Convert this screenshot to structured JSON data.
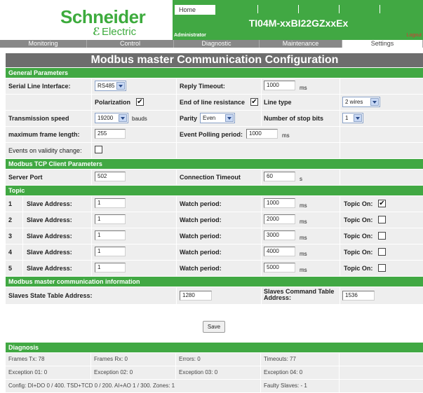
{
  "brand": {
    "name": "Schneider",
    "sub": "Electric"
  },
  "header": {
    "home_tab": "Home",
    "device_name": "TI04M-xxBI22GZxxEx",
    "user": "Administrator",
    "logout": "Logout"
  },
  "nav": [
    "Monitoring",
    "Control",
    "Diagnostic",
    "Maintenance",
    "Settings"
  ],
  "title": "Modbus master Communication Configuration",
  "general": {
    "heading": "General Parameters",
    "serial_label": "Serial Line Interface:",
    "serial_value": "RS485",
    "reply_label": "Reply Timeout:",
    "reply_value": "1000",
    "reply_unit": "ms",
    "polarization_label": "Polarization",
    "polarization_check": "✔",
    "eol_label": "End of line resistance",
    "eol_check": "✔",
    "linetype_label": "Line type",
    "linetype_value": "2 wires",
    "speed_label": "Transmission speed",
    "speed_value": "19200",
    "speed_unit": "bauds",
    "parity_label": "Parity",
    "parity_value": "Even",
    "stopbits_label": "Number of stop bits",
    "stopbits_value": "1",
    "framelen_label": "maximum frame length:",
    "framelen_value": "255",
    "polling_label": "Event Polling period:",
    "polling_value": "1000",
    "polling_unit": "ms",
    "events_label": "Events on validity change:"
  },
  "tcp": {
    "heading": "Modbus TCP Client Parameters",
    "port_label": "Server Port",
    "port_value": "502",
    "timeout_label": "Connection Timeout",
    "timeout_value": "60",
    "timeout_unit": "s"
  },
  "topic": {
    "heading": "Topic",
    "slave_label": "Slave Address:",
    "watch_label": "Watch period:",
    "watch_unit": "ms",
    "topic_on_label": "Topic On:",
    "rows": [
      {
        "num": "1",
        "slave": "1",
        "watch": "1000",
        "on": "✔"
      },
      {
        "num": "2",
        "slave": "1",
        "watch": "2000",
        "on": ""
      },
      {
        "num": "3",
        "slave": "1",
        "watch": "3000",
        "on": ""
      },
      {
        "num": "4",
        "slave": "1",
        "watch": "4000",
        "on": ""
      },
      {
        "num": "5",
        "slave": "1",
        "watch": "5000",
        "on": ""
      }
    ]
  },
  "info": {
    "heading": "Modbus master communication information",
    "state_label": "Slaves State Table Address:",
    "state_value": "1280",
    "cmd_label": "Slaves Command Table Address:",
    "cmd_value": "1536"
  },
  "save_label": "Save",
  "diagnosis": {
    "heading": "Diagnosis",
    "rows": [
      [
        "Frames Tx: 78",
        "Frames Rx: 0",
        "Errors: 0",
        "Timeouts: 77"
      ],
      [
        "Exception 01: 0",
        "Exception 02: 0",
        "Exception 03: 0",
        "Exception 04: 0"
      ]
    ],
    "config": "Config: DI+DO 0 / 400. TSD+TCD 0 / 200. AI+AO 1 / 300. Zones: 1",
    "faulty": "Faulty Slaves: - 1"
  },
  "colors": {
    "green": "#41a843",
    "gray_bar": "#6d6d6d",
    "cell": "#eeeeee"
  }
}
